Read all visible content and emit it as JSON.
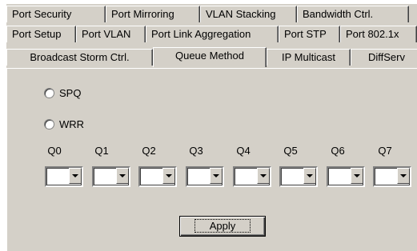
{
  "tabs": {
    "row1": [
      {
        "label": "Port Security"
      },
      {
        "label": "Port Mirroring"
      },
      {
        "label": "VLAN Stacking"
      },
      {
        "label": "Bandwidth Ctrl."
      }
    ],
    "row2": [
      {
        "label": "Port Setup"
      },
      {
        "label": "Port VLAN"
      },
      {
        "label": "Port Link Aggregation"
      },
      {
        "label": "Port STP"
      },
      {
        "label": "Port 802.1x"
      }
    ],
    "row3": [
      {
        "label": "Broadcast Storm Ctrl."
      },
      {
        "label": "Queue Method",
        "active": true
      },
      {
        "label": "IP Multicast"
      },
      {
        "label": "DiffServ"
      }
    ]
  },
  "queue_method": {
    "options": [
      {
        "label": "SPQ",
        "selected": false
      },
      {
        "label": "WRR",
        "selected": false
      }
    ],
    "queues": [
      {
        "label": "Q0",
        "value": ""
      },
      {
        "label": "Q1",
        "value": ""
      },
      {
        "label": "Q2",
        "value": ""
      },
      {
        "label": "Q3",
        "value": ""
      },
      {
        "label": "Q4",
        "value": ""
      },
      {
        "label": "Q5",
        "value": ""
      },
      {
        "label": "Q6",
        "value": ""
      },
      {
        "label": "Q7",
        "value": ""
      }
    ],
    "apply_label": "Apply"
  }
}
